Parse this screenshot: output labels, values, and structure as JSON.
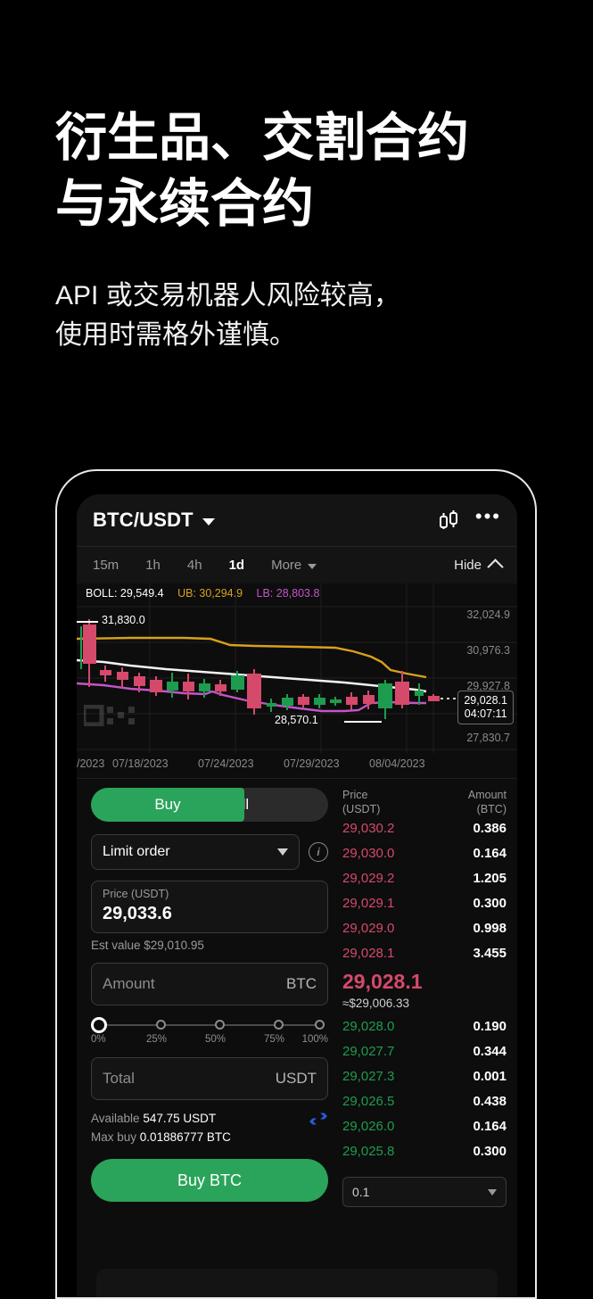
{
  "promo": {
    "headline": "衍生品、交割合约\n与永续合约",
    "subhead": "API 或交易机器人风险较高，\n使用时需格外谨慎。"
  },
  "colors": {
    "buy_green": "#2aa45a",
    "ask_red": "#d5496b",
    "bid_green": "#1d9c4f",
    "boll_upper": "#d8a11c",
    "boll_lower": "#c455c9",
    "boll_mid": "#ffffff",
    "swap_blue": "#2a5ada",
    "page_bg": "#000000",
    "panel_bg": "#141414"
  },
  "app": {
    "header": {
      "pair": "BTC/USDT",
      "caret": "chevron-down-icon",
      "chart_type_icon": "candlestick-icon",
      "more_icon": "more-dots-icon"
    },
    "timeframes": [
      {
        "label": "15m",
        "active": false
      },
      {
        "label": "1h",
        "active": false
      },
      {
        "label": "4h",
        "active": false
      },
      {
        "label": "1d",
        "active": true
      }
    ],
    "more_label": "More",
    "hide_label": "Hide"
  },
  "chart": {
    "indicator": {
      "mid_label": "BOLL: 29,549.4",
      "upper_label": "UB: 30,294.9",
      "lower_label": "LB: 28,803.8"
    },
    "y_labels": [
      "32,024.9",
      "30,976.3",
      "29,927.8",
      "27,830.7"
    ],
    "high_marker": "31,830.0",
    "low_marker": "28,570.1",
    "last_price_badge": "29,028.1",
    "countdown_badge": "04:07:11",
    "watermark": "OKX",
    "x_labels": [
      "/2023",
      "07/18/2023",
      "07/24/2023",
      "07/29/2023",
      "08/04/2023"
    ]
  },
  "chart_data": {
    "type": "line",
    "title": "BTC/USDT 1d candlestick with BOLL",
    "ylim": [
      27830.7,
      32024.9
    ],
    "ytick_labels": [
      "32,024.9",
      "30,976.3",
      "29,927.8",
      "27,830.7"
    ],
    "xtick_labels": [
      "/2023",
      "07/18/2023",
      "07/24/2023",
      "07/29/2023",
      "08/04/2023"
    ],
    "series": [
      {
        "name": "BOLL upper (UB)",
        "last_value": 30294.9,
        "color": "#d8a11c"
      },
      {
        "name": "BOLL middle",
        "last_value": 29549.4,
        "color": "#ffffff"
      },
      {
        "name": "BOLL lower (LB)",
        "last_value": 28803.8,
        "color": "#c455c9"
      }
    ],
    "annotations": [
      "31,830.0",
      "28,570.1",
      "29,028.1"
    ]
  },
  "form": {
    "side_buy": "Buy",
    "side_sell": "Sell",
    "order_type": "Limit order",
    "info_icon": "info-icon",
    "price_label": "Price (USDT)",
    "price_value": "29,033.6",
    "est_value": "Est value $29,010.95",
    "amount_placeholder": "Amount",
    "amount_unit": "BTC",
    "slider_ticks": [
      "0%",
      "25%",
      "50%",
      "75%",
      "100%"
    ],
    "slider_position": "0%",
    "total_placeholder": "Total",
    "total_unit": "USDT",
    "available_label": "Available",
    "available_value": "547.75 USDT",
    "maxbuy_label": "Max buy",
    "maxbuy_value": "0.01886777 BTC",
    "swap_icon": "swap-arrows-icon",
    "submit_label": "Buy BTC"
  },
  "orderbook": {
    "col_price": "Price",
    "col_price_unit": "(USDT)",
    "col_amount": "Amount",
    "col_amount_unit": "(BTC)",
    "asks": [
      {
        "price": "29,030.2",
        "amount": "0.386"
      },
      {
        "price": "29,030.0",
        "amount": "0.164"
      },
      {
        "price": "29,029.2",
        "amount": "1.205"
      },
      {
        "price": "29,029.1",
        "amount": "0.300"
      },
      {
        "price": "29,029.0",
        "amount": "0.998"
      },
      {
        "price": "29,028.1",
        "amount": "3.455"
      }
    ],
    "last_price": "29,028.1",
    "last_approx": "≈$29,006.33",
    "bids": [
      {
        "price": "29,028.0",
        "amount": "0.190"
      },
      {
        "price": "29,027.7",
        "amount": "0.344"
      },
      {
        "price": "29,027.3",
        "amount": "0.001"
      },
      {
        "price": "29,026.5",
        "amount": "0.438"
      },
      {
        "price": "29,026.0",
        "amount": "0.164"
      },
      {
        "price": "29,025.8",
        "amount": "0.300"
      }
    ],
    "grouping": "0.1"
  }
}
